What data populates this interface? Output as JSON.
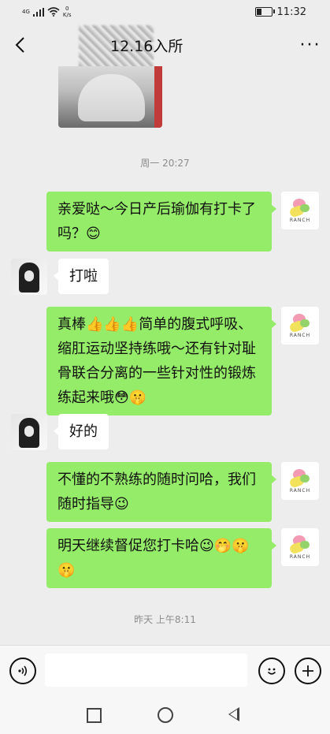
{
  "status_bar": {
    "network": "4G",
    "speed_value": "0",
    "speed_unit": "K/s",
    "time": "11:32"
  },
  "header": {
    "title": "12.16入所"
  },
  "timestamps": [
    "周一 20:27",
    "昨天 上午8:11"
  ],
  "messages": [
    {
      "sender": "me",
      "text": "亲爱哒～今日产后瑜伽有打卡了吗？😊"
    },
    {
      "sender": "other",
      "text": "打啦"
    },
    {
      "sender": "me",
      "text": "真棒👍👍👍简单的腹式呼吸、缩肛运动坚持练哦～还有针对耻骨联合分离的一些针对性的锻炼练起来哦😳🤫"
    },
    {
      "sender": "other",
      "text": "好的"
    },
    {
      "sender": "me",
      "text": "不懂的不熟练的随时问哈，我们随时指导😉"
    },
    {
      "sender": "me",
      "text": "明天继续督促您打卡哈😉🤭🤫🤫"
    }
  ],
  "avatar_logo_text": "RANCH",
  "input_bar": {
    "placeholder": ""
  },
  "icons": {
    "back": "back-arrow-icon",
    "more": "more-icon",
    "voice": "voice-icon",
    "emoji": "emoji-icon",
    "add": "add-icon"
  }
}
